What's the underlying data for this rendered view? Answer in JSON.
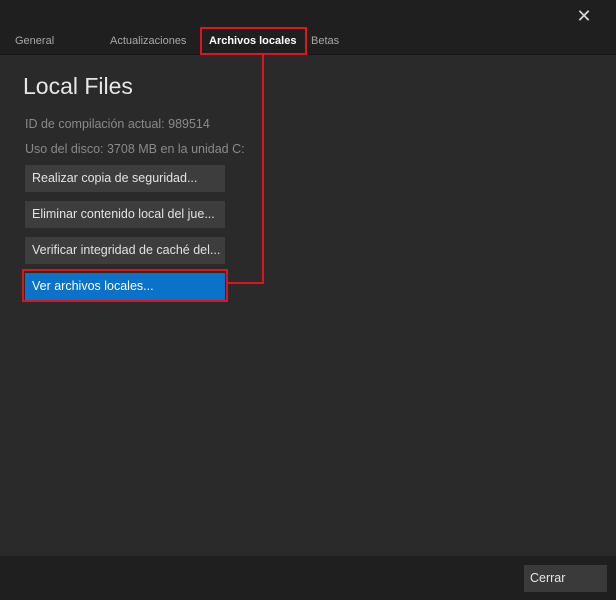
{
  "window": {
    "close_glyph": "✕"
  },
  "tabs": [
    {
      "label": "General",
      "active": false
    },
    {
      "label": "Actualizaciones",
      "active": false
    },
    {
      "label": "Archivos locales",
      "active": true
    },
    {
      "label": "Betas",
      "active": false
    }
  ],
  "content": {
    "title": "Local Files",
    "build_id": "ID de compilación actual: 989514",
    "disk_usage": "Uso del disco: 3708 MB en la unidad C:",
    "buttons": {
      "backup": "Realizar copia de seguridad...",
      "delete": "Eliminar contenido local del jue...",
      "verify": "Verificar integridad de caché del...",
      "browse": "Ver archivos locales..."
    }
  },
  "footer": {
    "close_label": "Cerrar"
  },
  "colors": {
    "accent": "#0a72c8",
    "highlight": "#e0141e",
    "background": "#2a2a2a"
  },
  "icons": {
    "close": "close-icon"
  }
}
